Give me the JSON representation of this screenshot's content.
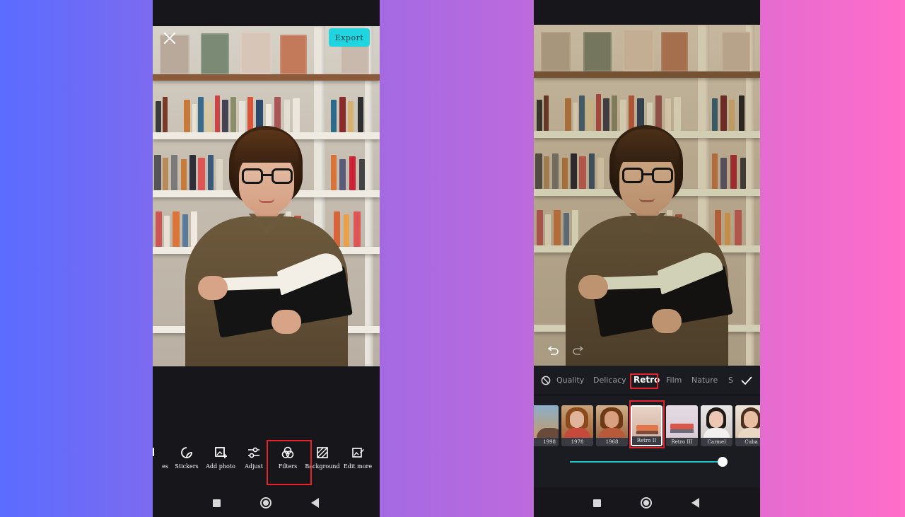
{
  "left_screen": {
    "export_label": "Export",
    "toolbar": [
      {
        "label": "es",
        "icon": "cut-off-icon"
      },
      {
        "label": "Stickers",
        "icon": "sticker-icon"
      },
      {
        "label": "Add photo",
        "icon": "add-photo-icon"
      },
      {
        "label": "Adjust",
        "icon": "sliders-icon"
      },
      {
        "label": "Filters",
        "icon": "filters-icon",
        "highlighted": true
      },
      {
        "label": "Background",
        "icon": "background-icon"
      },
      {
        "label": "Edit more",
        "icon": "edit-more-icon"
      }
    ]
  },
  "right_screen": {
    "categories": [
      {
        "label": "Quality"
      },
      {
        "label": "Delicacy"
      },
      {
        "label": "Retro",
        "active": true
      },
      {
        "label": "Film"
      },
      {
        "label": "Nature"
      },
      {
        "label": "S"
      }
    ],
    "filters": [
      {
        "name": "1998"
      },
      {
        "name": "1978"
      },
      {
        "name": "1968"
      },
      {
        "name": "Retro II",
        "selected": true
      },
      {
        "name": "Retro III"
      },
      {
        "name": "Carmel"
      },
      {
        "name": "Cuba"
      }
    ],
    "intensity": 1.0
  },
  "colors": {
    "accent_cyan": "#1fd5df",
    "highlight_red": "#e5232d",
    "panel_dark": "#16161b"
  }
}
